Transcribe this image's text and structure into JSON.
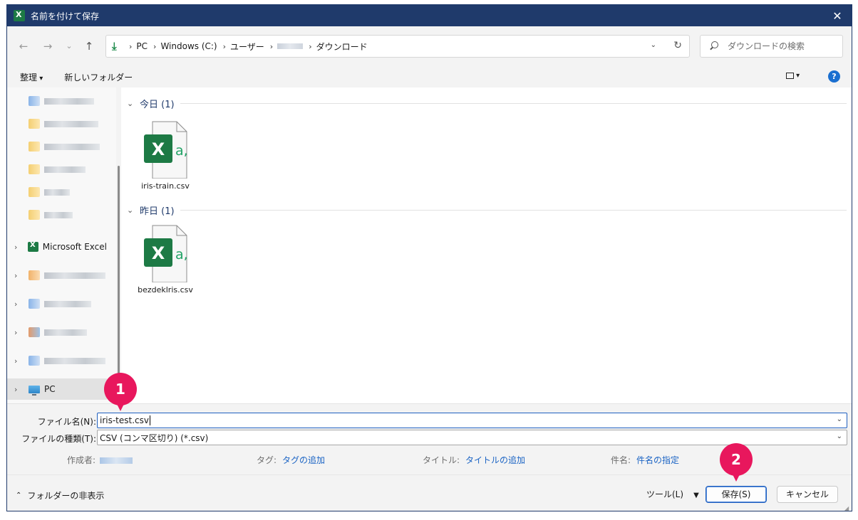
{
  "window": {
    "title": "名前を付けて保存",
    "close_glyph": "✕"
  },
  "nav_buttons": {
    "back": "←",
    "forward": "→",
    "recent": "⌄",
    "up": "↑"
  },
  "address": {
    "crumbs": [
      "PC",
      "Windows (C:)",
      "ユーザー",
      "ダウンロード"
    ],
    "separator": "›",
    "chevron": "⌄",
    "refresh": "↻"
  },
  "search": {
    "placeholder": "ダウンロードの検索"
  },
  "commandbar": {
    "organize": "整理",
    "new_folder": "新しいフォルダー",
    "help": "?"
  },
  "navpane": {
    "chevron": "›",
    "items": [
      {
        "label": "Microsoft Excel"
      },
      {
        "label": "PC"
      }
    ]
  },
  "content": {
    "groups": [
      {
        "label": "今日 (1)",
        "files": [
          {
            "name": "iris-train.csv"
          }
        ]
      },
      {
        "label": "昨日 (1)",
        "files": [
          {
            "name": "bezdeklris.csv"
          }
        ]
      }
    ],
    "group_chevron": "⌄",
    "icon_letter": "X",
    "icon_mark": "a,"
  },
  "form": {
    "filename_label": "ファイル名(N):",
    "filename_value": "iris-test.csv",
    "filetype_label": "ファイルの種類(T):",
    "filetype_value": "CSV (コンマ区切り) (*.csv)",
    "dropdown_glyph": "⌄",
    "author_label": "作成者:",
    "tags_label": "タグ:",
    "tags_value": "タグの追加",
    "title_label": "タイトル:",
    "title_value": "タイトルの追加",
    "subject_label": "件名:",
    "subject_value": "件名の指定"
  },
  "bottom": {
    "hide_folders": "フォルダーの非表示",
    "hide_glyph": "⌃",
    "tools": "ツール(L)",
    "tools_glyph": "▼",
    "save": "保存(S)",
    "cancel": "キャンセル"
  },
  "callouts": [
    "1",
    "2"
  ],
  "colors": {
    "titlebar": "#1f3a6b",
    "accent": "#1a63c4",
    "excel_green": "#1d7a45",
    "callout": "#e8175d"
  }
}
